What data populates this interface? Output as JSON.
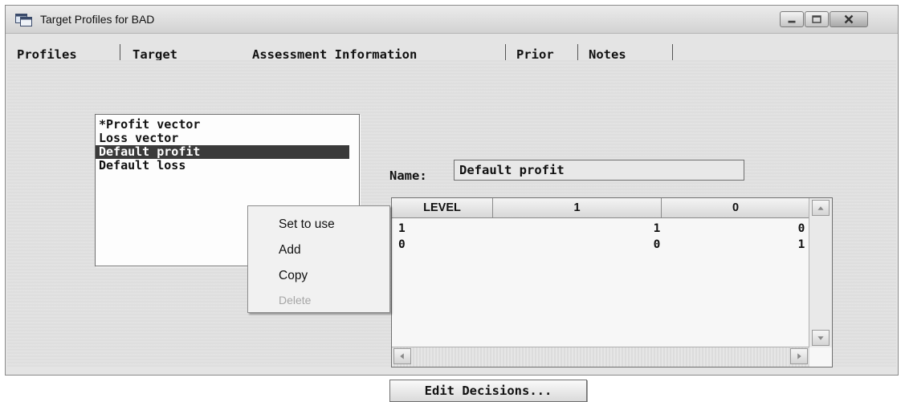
{
  "window": {
    "title": "Target Profiles for BAD",
    "icon": "sas-window-icon",
    "controls": {
      "minimize": "minimize-icon",
      "maximize": "maximize-icon",
      "close": "close-icon"
    }
  },
  "tabs": [
    {
      "label": "Profiles",
      "active": true
    },
    {
      "label": "Target"
    },
    {
      "label": "Assessment Information"
    },
    {
      "label": "Prior"
    },
    {
      "label": "Notes"
    }
  ],
  "profiles_list": {
    "items": [
      {
        "label": "*Profit vector"
      },
      {
        "label": "Loss vector"
      },
      {
        "label": "Default profit",
        "selected": true
      },
      {
        "label": "Default loss"
      }
    ]
  },
  "context_menu": {
    "items": [
      {
        "label": "Set to use",
        "enabled": true
      },
      {
        "label": "Add",
        "enabled": true
      },
      {
        "label": "Copy",
        "enabled": true
      },
      {
        "label": "Delete",
        "enabled": false
      }
    ]
  },
  "name_field": {
    "label": "Name:",
    "value": "Default profit"
  },
  "matrix": {
    "columns": [
      "LEVEL",
      "1",
      "0"
    ],
    "rows": [
      [
        "1",
        "1",
        "0"
      ],
      [
        "0",
        "0",
        "1"
      ]
    ]
  },
  "edit_decisions": {
    "label": "Edit Decisions..."
  },
  "colors": {
    "selection": "#3a3a3a",
    "background": "#e2e2e2",
    "disabled_text": "#a6a6a6"
  }
}
